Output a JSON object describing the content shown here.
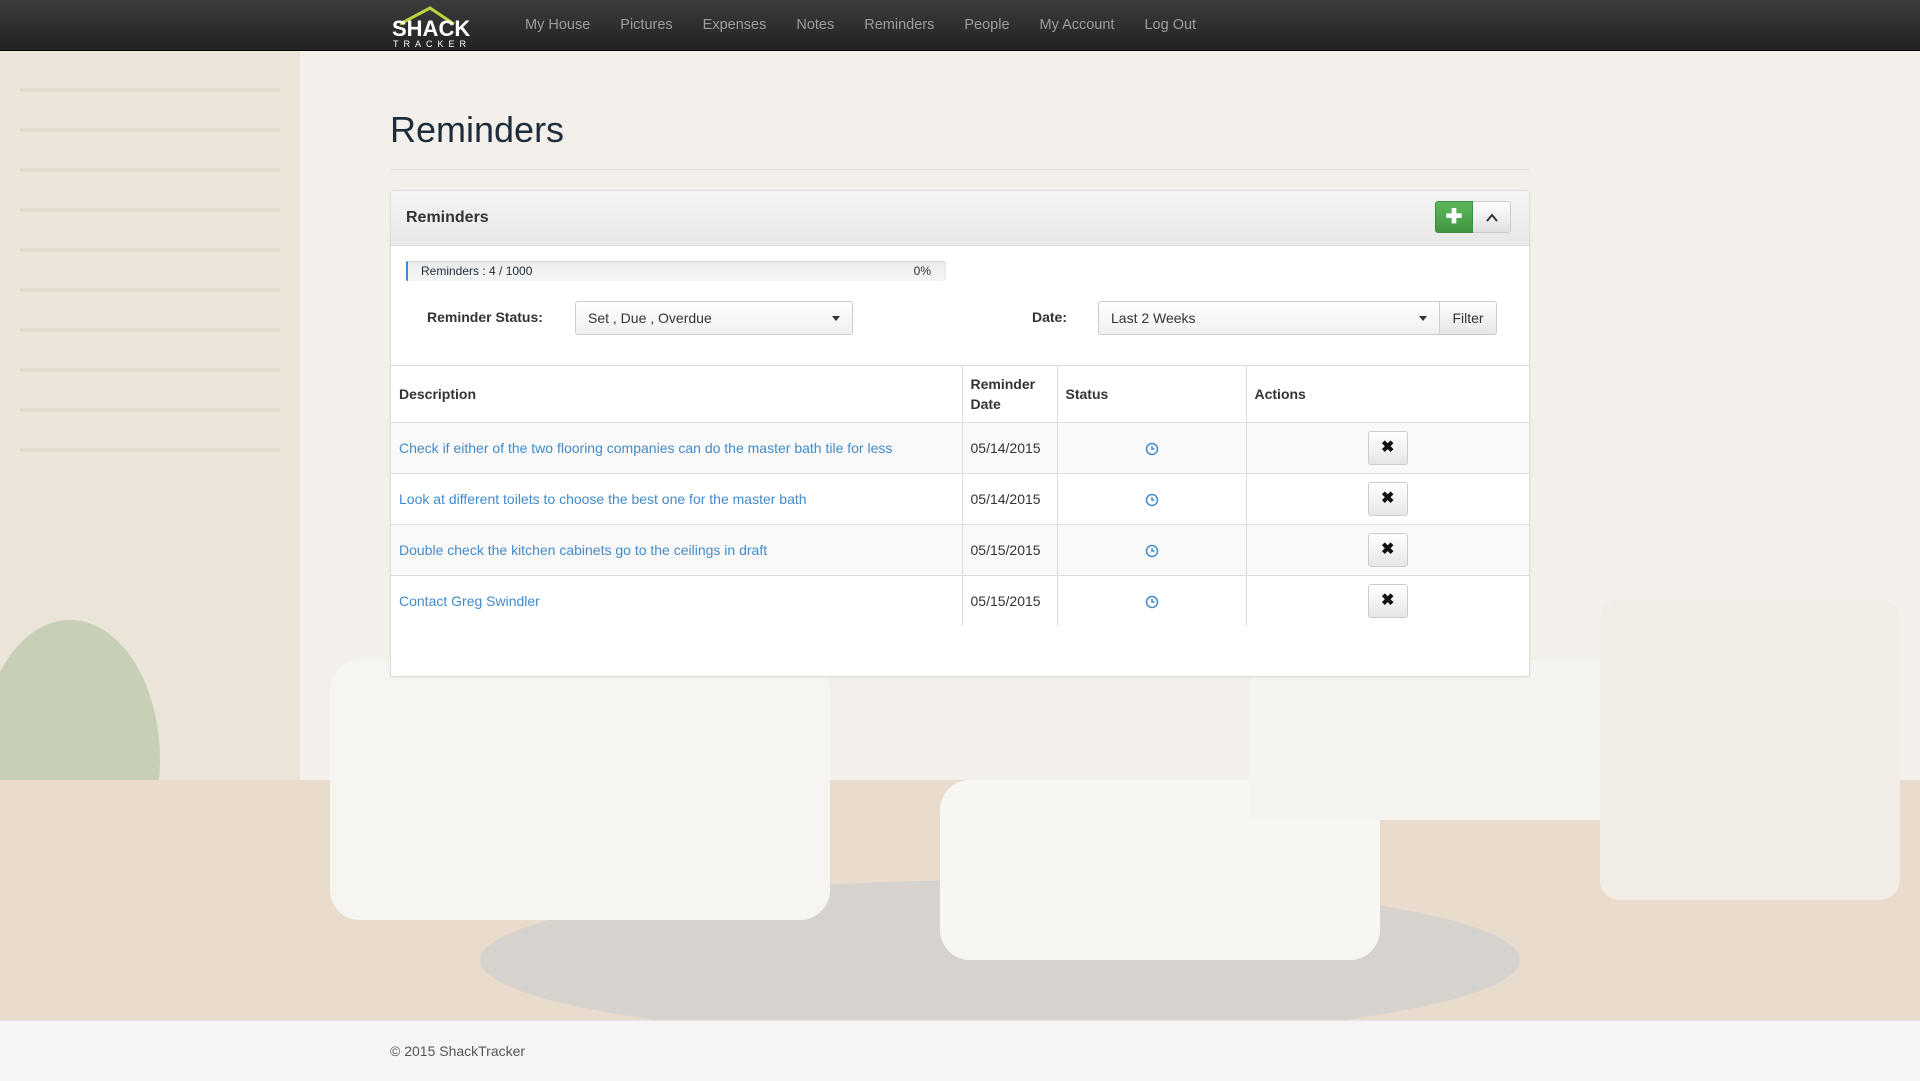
{
  "brand": {
    "name_top": "SHACK",
    "name_bottom": "TRACKER"
  },
  "nav": {
    "items": [
      {
        "label": "My House"
      },
      {
        "label": "Pictures"
      },
      {
        "label": "Expenses"
      },
      {
        "label": "Notes"
      },
      {
        "label": "Reminders"
      },
      {
        "label": "People"
      },
      {
        "label": "My Account"
      },
      {
        "label": "Log Out"
      }
    ]
  },
  "page": {
    "title": "Reminders"
  },
  "panel": {
    "title": "Reminders",
    "add_icon": "plus-icon",
    "collapse_icon": "chevron-up-icon",
    "progress": {
      "label": "Reminders : 4 / 1000",
      "percent_text": "0%",
      "fraction": 0.004
    },
    "filters": {
      "status_label": "Reminder Status:",
      "status_value": "Set , Due , Overdue",
      "date_label": "Date:",
      "date_value": "Last 2 Weeks",
      "filter_button": "Filter"
    },
    "table": {
      "headers": {
        "description": "Description",
        "date": "Reminder Date",
        "status": "Status",
        "actions": "Actions"
      },
      "rows": [
        {
          "description": "Check if either of the two flooring companies can do the master bath tile for less",
          "date": "05/14/2015",
          "status_icon": "clock-icon",
          "action_icon": "close-icon"
        },
        {
          "description": "Look at different toilets to choose the best one for the master bath",
          "date": "05/14/2015",
          "status_icon": "clock-icon",
          "action_icon": "close-icon"
        },
        {
          "description": "Double check the kitchen cabinets go to the ceilings in draft",
          "date": "05/15/2015",
          "status_icon": "clock-icon",
          "action_icon": "close-icon"
        },
        {
          "description": "Contact Greg Swindler",
          "date": "05/15/2015",
          "status_icon": "clock-icon",
          "action_icon": "close-icon"
        }
      ]
    }
  },
  "footer": {
    "text": "© 2015 ShackTracker"
  },
  "colors": {
    "accent": "#428bca",
    "success": "#5cb85c",
    "navbar": "#222222",
    "logo_green": "#b9d43c"
  }
}
